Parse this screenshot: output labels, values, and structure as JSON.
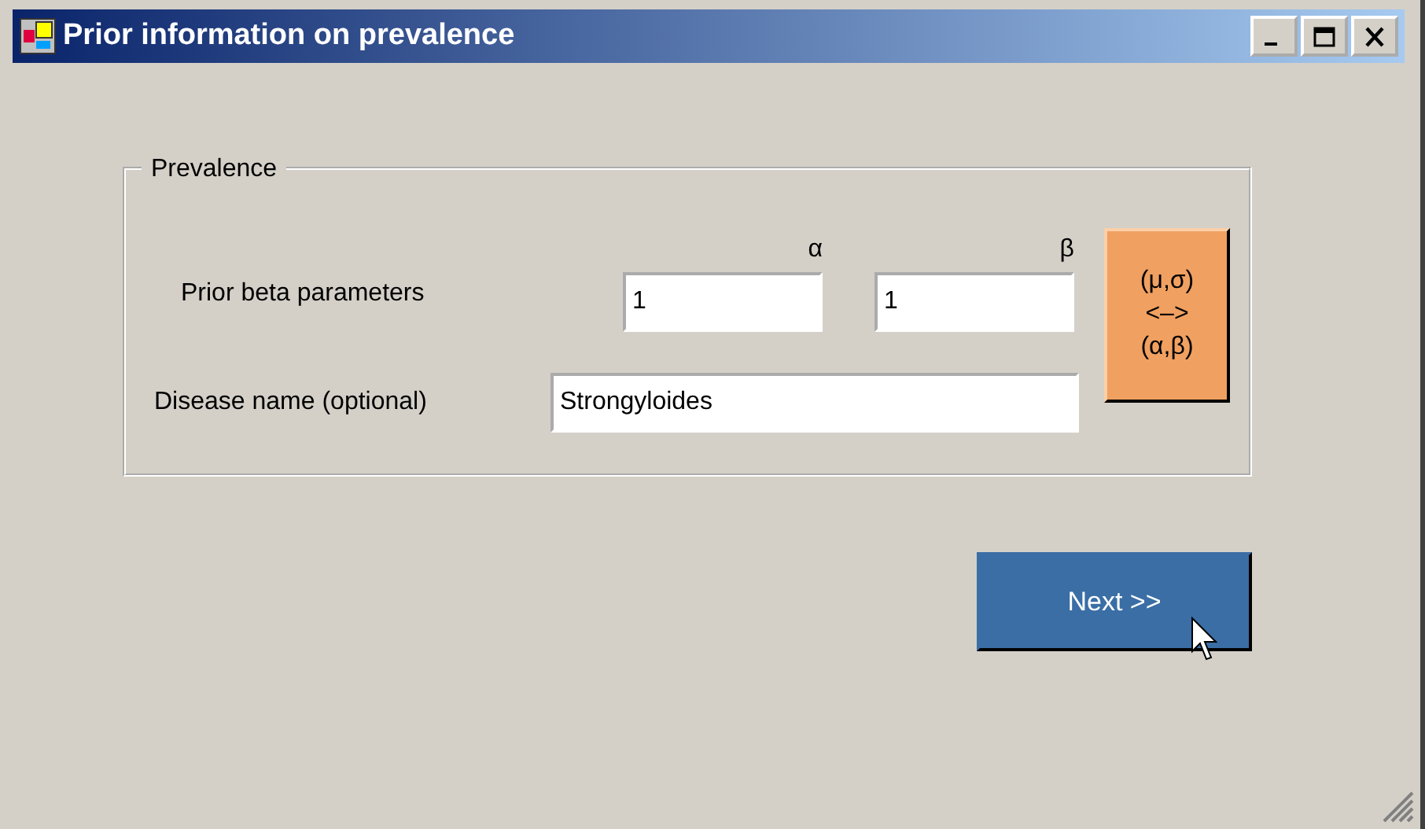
{
  "window": {
    "title": "Prior information on prevalence",
    "controls": [
      {
        "kind": "minimize"
      },
      {
        "kind": "maximize"
      },
      {
        "kind": "close"
      }
    ]
  },
  "group": {
    "legend": "Prevalence",
    "beta_row": {
      "label": "Prior beta parameters",
      "fields": [
        {
          "caption": "α",
          "value": "1"
        },
        {
          "caption": "β",
          "value": "1"
        }
      ]
    },
    "name_row": {
      "label": "Disease name (optional)",
      "value": "Strongyloides"
    },
    "convert_button": {
      "lines": [
        "(μ,σ)",
        "<–>",
        "(α,β)"
      ]
    }
  },
  "next_button": "Next >>"
}
